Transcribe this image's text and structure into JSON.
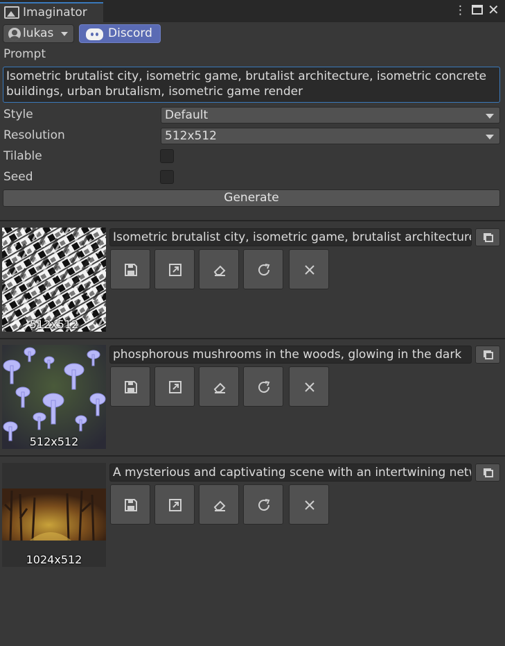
{
  "window": {
    "title": "Imaginator",
    "menu_icon": "kebab-menu-icon",
    "maximize_icon": "maximize-icon",
    "close_icon": "close-icon"
  },
  "toolbar": {
    "user_label": "lukas",
    "discord_label": "Discord"
  },
  "form": {
    "prompt_label": "Prompt",
    "prompt_value": "Isometric brutalist city, isometric game, brutalist architecture, isometric concrete buildings, urban brutalism, isometric game render",
    "style_label": "Style",
    "style_value": "Default",
    "resolution_label": "Resolution",
    "resolution_value": "512x512",
    "tilable_label": "Tilable",
    "tilable_checked": false,
    "seed_label": "Seed",
    "seed_checked": false,
    "generate_label": "Generate"
  },
  "generations": [
    {
      "prompt": "Isometric brutalist city, isometric game, brutalist architecture, isometric concrete buildings",
      "resolution": "512x512"
    },
    {
      "prompt": "phosphorous mushrooms in the woods, glowing in the dark",
      "resolution": "512x512"
    },
    {
      "prompt": "A mysterious and captivating scene with an intertwining network of trees",
      "resolution": "1024x512"
    }
  ],
  "action_icons": [
    "save-icon",
    "open-external-icon",
    "eraser-icon",
    "refresh-icon",
    "delete-icon"
  ],
  "colors": {
    "accent": "#3a79bb",
    "discord": "#5a6bb4",
    "background": "#383838"
  }
}
